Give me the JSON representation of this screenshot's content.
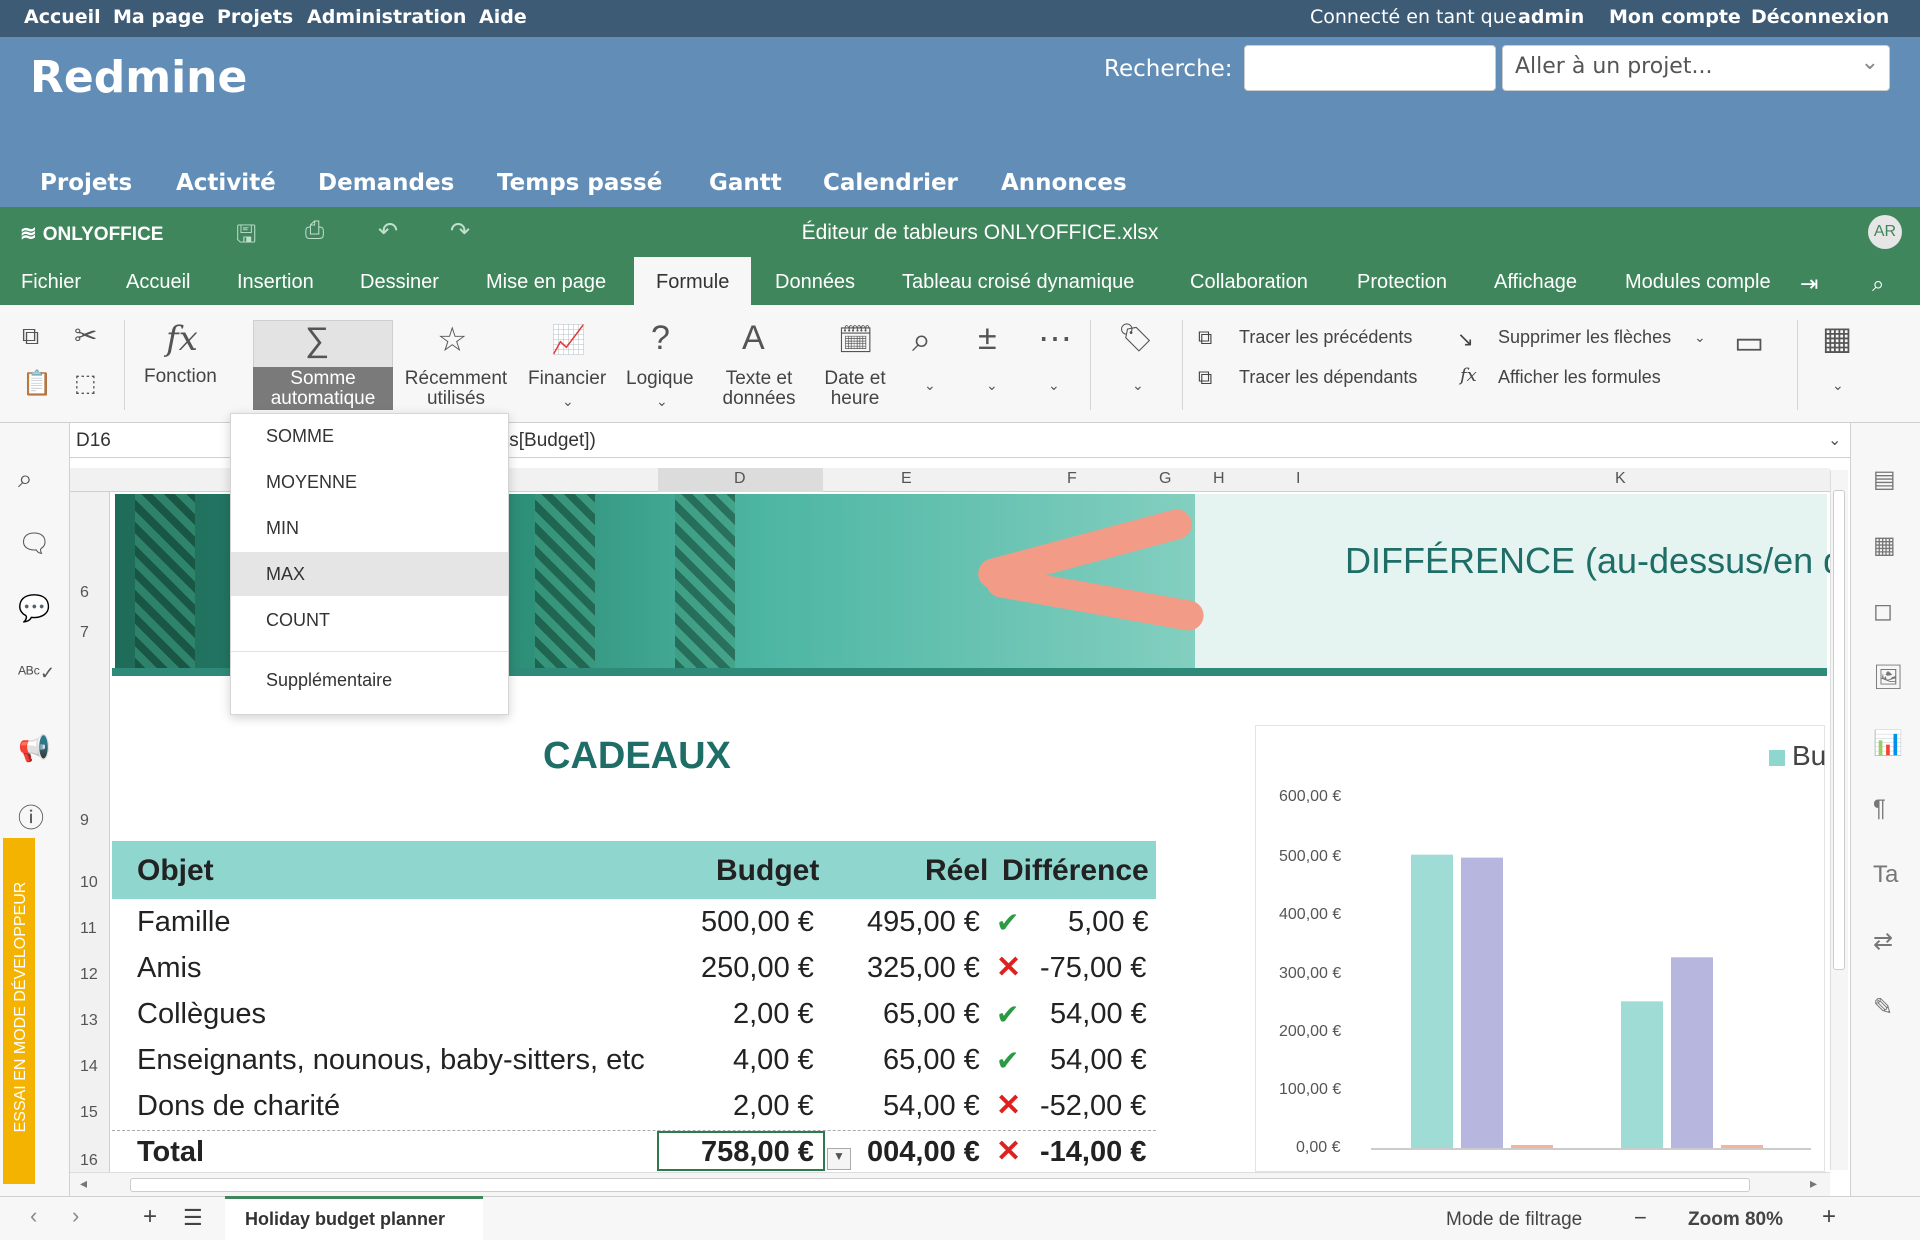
{
  "redmine": {
    "top_left": [
      "Accueil",
      "Ma page",
      "Projets",
      "Administration",
      "Aide"
    ],
    "logged_prefix": "Connecté en tant que",
    "logged_user": "admin",
    "my_account": "Mon compte",
    "logout": "Déconnexion",
    "title": "Redmine",
    "search_label": "Recherche:",
    "search_value": "",
    "project_jump": "Aller à un projet...",
    "menu": [
      "Projets",
      "Activité",
      "Demandes",
      "Temps passé",
      "Gantt",
      "Calendrier",
      "Annonces"
    ]
  },
  "onlyoffice": {
    "brand": "ONLYOFFICE",
    "doc_title": "Éditeur de tableurs ONLYOFFICE.xlsx",
    "avatar": "AR",
    "tabs": [
      "Fichier",
      "Accueil",
      "Insertion",
      "Dessiner",
      "Mise en page",
      "Formule",
      "Données",
      "Tableau croisé dynamique",
      "Collaboration",
      "Protection",
      "Affichage",
      "Modules comple"
    ],
    "active_tab": "Formule"
  },
  "ribbon": {
    "fonction": "Fonction",
    "somme_l1": "Somme",
    "somme_l2": "automatique",
    "recent_l1": "Récemment",
    "recent_l2": "utilisés",
    "financier": "Financier",
    "logique": "Logique",
    "texte_l1": "Texte et",
    "texte_l2": "données",
    "date_l1": "Date et",
    "date_l2": "heure",
    "tracer_prec": "Tracer les précédents",
    "tracer_dep": "Tracer les dépendants",
    "suppr_fleches": "Supprimer les flèches",
    "afficher_formules": "Afficher les formules"
  },
  "formula_bar": {
    "cell_ref": "D16",
    "formula_visible": "ts[Budget])"
  },
  "dropdown": {
    "options": [
      "SOMME",
      "MOYENNE",
      "MIN",
      "MAX",
      "COUNT"
    ],
    "highlighted": "MAX",
    "more": "Supplémentaire"
  },
  "dev_mode": "ESSAI EN MODE DÉVELOPPEUR",
  "sheet": {
    "columns": [
      "D",
      "E",
      "F",
      "G",
      "H",
      "I",
      "K"
    ],
    "rows": [
      "6",
      "7",
      "9",
      "10",
      "11",
      "12",
      "13",
      "14",
      "15",
      "16"
    ],
    "banner_text": "DIFFÉRENCE (au-dessus/en d",
    "title": "CADEAUX",
    "table": {
      "headers": [
        "Objet",
        "Budget",
        "Réel",
        "Différence"
      ],
      "rows": [
        {
          "objet": "Famille",
          "budget": "500,00 €",
          "reel": "495,00 €",
          "status": "ok",
          "diff": "5,00 €"
        },
        {
          "objet": "Amis",
          "budget": "250,00 €",
          "reel": "325,00 €",
          "status": "ko",
          "diff": "-75,00 €"
        },
        {
          "objet": "Collègues",
          "budget": "2,00 €",
          "reel": "65,00 €",
          "status": "ok",
          "diff": "54,00 €"
        },
        {
          "objet": "Enseignants, nounous, baby-sitters, etc",
          "budget": "4,00 €",
          "reel": "65,00 €",
          "status": "ok",
          "diff": "54,00 €"
        },
        {
          "objet": "Dons de charité",
          "budget": "2,00 €",
          "reel": "54,00 €",
          "status": "ko",
          "diff": "-52,00 €"
        }
      ],
      "total": {
        "objet": "Total",
        "budget": "758,00 €",
        "reel": "004,00 €",
        "status": "ko",
        "diff": "-14,00 €"
      }
    }
  },
  "chart_data": {
    "type": "bar",
    "legend": "Bu",
    "y_ticks": [
      "600,00 €",
      "500,00 €",
      "400,00 €",
      "300,00 €",
      "200,00 €",
      "100,00 €",
      "0,00 €"
    ],
    "ylim": [
      0,
      600
    ],
    "series": [
      {
        "values": [
          500,
          250
        ],
        "color": "#8fd6cf"
      },
      {
        "values": [
          495,
          325
        ],
        "color": "#a9a9d9"
      },
      {
        "values": [
          5,
          0
        ],
        "color": "#f2a68a"
      }
    ]
  },
  "statusbar": {
    "sheet_name": "Holiday budget planner",
    "filter_mode": "Mode de filtrage",
    "zoom": "Zoom 80%"
  }
}
